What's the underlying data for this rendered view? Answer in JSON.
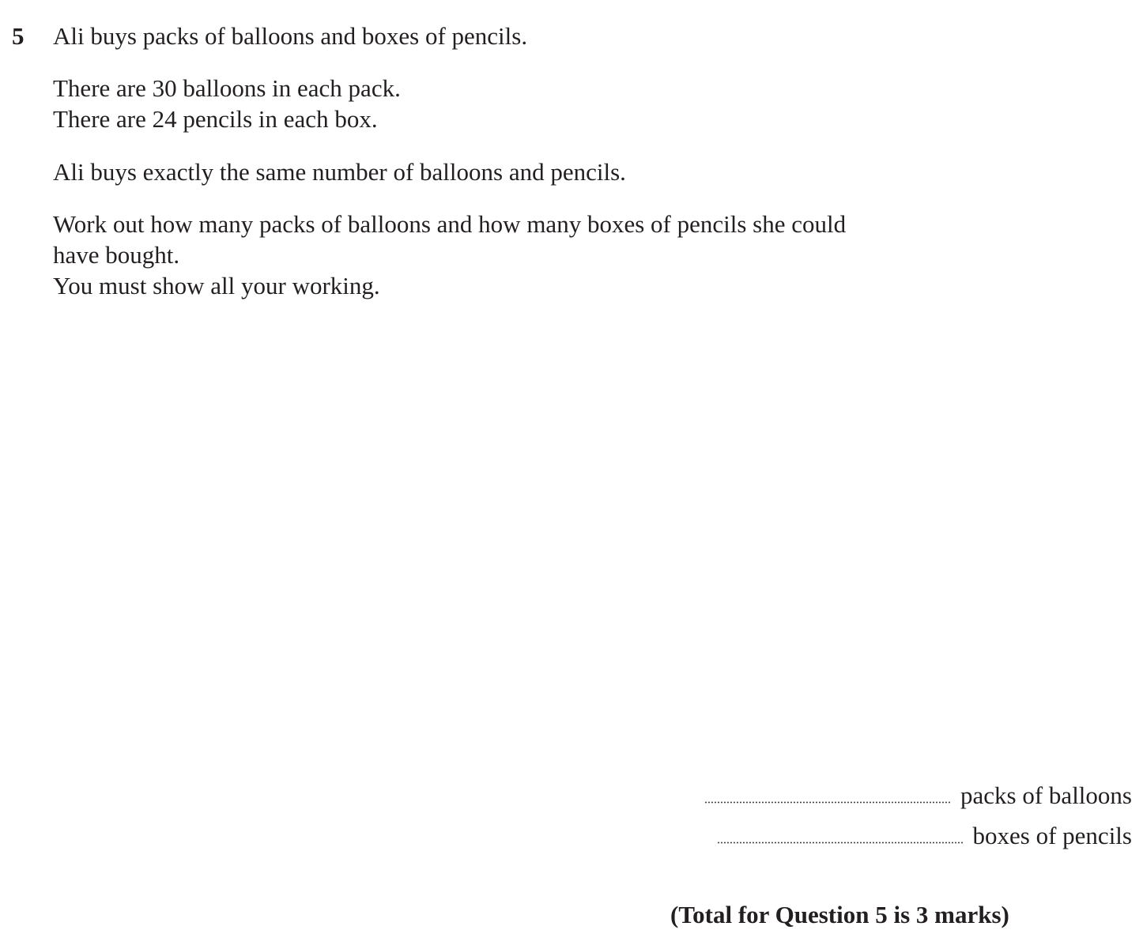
{
  "question": {
    "number": "5",
    "lines": [
      "Ali buys packs of balloons and boxes of pencils.",
      "There are 30 balloons in each pack.",
      "There are 24 pencils in each box.",
      "Ali buys exactly the same number of balloons and pencils.",
      "Work out how many packs of balloons and how many boxes of pencils she could",
      "have bought.",
      "You must show all your working."
    ]
  },
  "answers": {
    "balloons_label": "packs of balloons",
    "pencils_label": "boxes of pencils"
  },
  "total": "(Total for Question 5 is 3 marks)"
}
